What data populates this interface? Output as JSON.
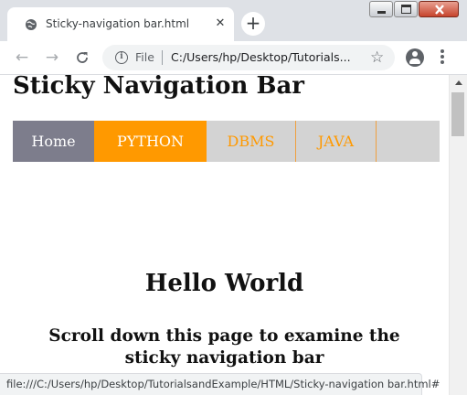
{
  "browser": {
    "tab": {
      "title": "Sticky-navigation bar.html",
      "icon": "globe-icon",
      "close_icon": "close-icon"
    },
    "new_tab_icon": "plus-icon",
    "window_controls": [
      "minimize-icon",
      "maximize-icon",
      "close-icon"
    ],
    "toolbar": {
      "back_icon": "arrow-left-icon",
      "forward_icon": "arrow-right-icon",
      "reload_icon": "reload-icon",
      "scheme_label": "File",
      "url": "C:/Users/hp/Desktop/Tutorials...",
      "bookmark_icon": "star-icon",
      "account_icon": "account-icon",
      "menu_icon": "kebab-menu-icon"
    },
    "status_url": "file:///C:/Users/hp/Desktop/TutorialsandExample/HTML/Sticky-navigation bar.html#"
  },
  "page": {
    "heading": "Sticky Navigation Bar",
    "nav": [
      {
        "label": "Home",
        "state": "hover"
      },
      {
        "label": "PYTHON",
        "state": "active"
      },
      {
        "label": "DBMS",
        "state": "normal"
      },
      {
        "label": "JAVA",
        "state": "normal"
      }
    ],
    "hello": "Hello World",
    "scroll_message": "Scroll down this page to examine the sticky navigation bar"
  },
  "colors": {
    "navbar_bg": "#d3d3d3",
    "nav_hover_bg": "#7d7d8c",
    "nav_active_bg": "#ff9900",
    "nav_link": "#ff9900"
  }
}
